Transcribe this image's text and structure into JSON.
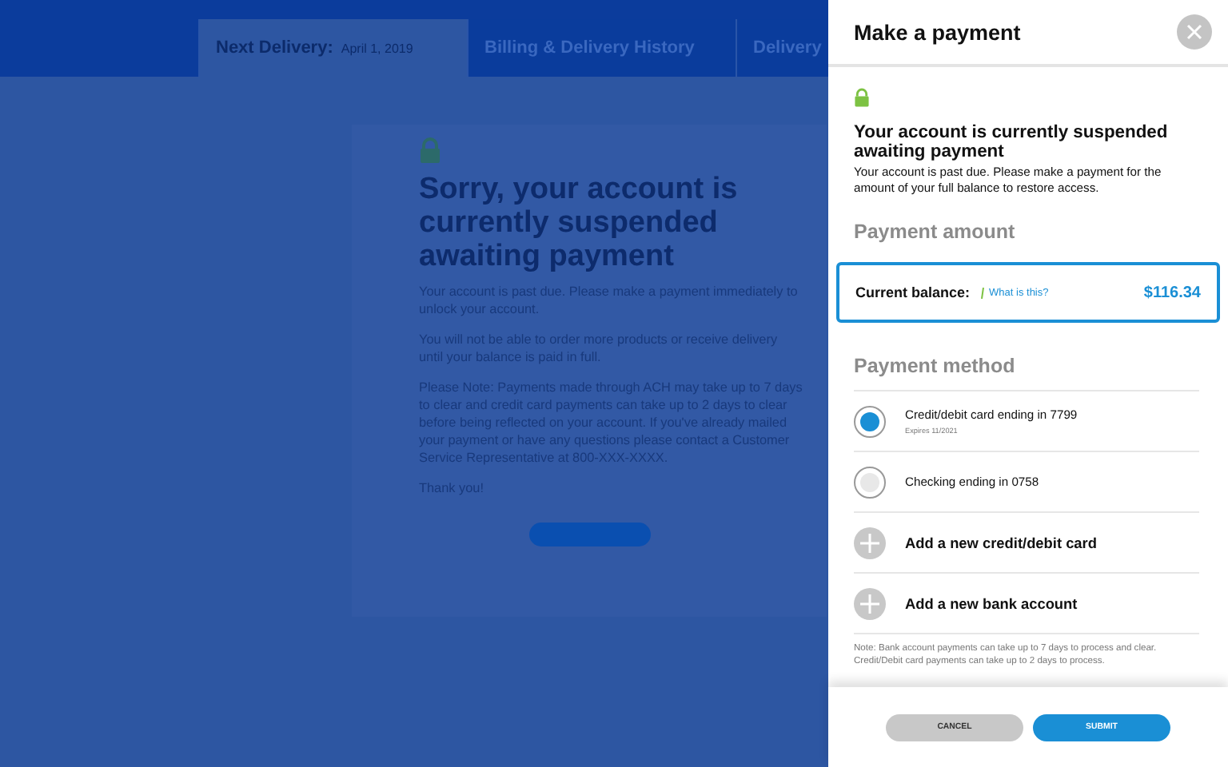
{
  "tabs": [
    {
      "label": "Next Delivery:",
      "detail": "April 1, 2019",
      "selected": true
    },
    {
      "label": "Billing & Delivery History",
      "selected": false
    },
    {
      "label": "Delivery",
      "selected": false
    }
  ],
  "notice": {
    "title": "Sorry, your account is currently suspended awaiting payment",
    "paragraphs": [
      "Your account is past due. Please make a payment immediately to unlock your account.",
      "You will not be able to order more products or receive delivery until your balance is paid in full.",
      "Please Note: Payments made through ACH may take up to 7 days to clear and credit card payments can take up to 2 days to clear before being reflected on your account. If you've already mailed your payment or have any questions please contact a Customer Service Representative at 800-XXX-XXXX.",
      "Thank you!"
    ]
  },
  "panel": {
    "title": "Make a payment",
    "alert_title": "Your account is currently suspended awaiting payment",
    "alert_text": "Your account is past due. Please make a payment for the amount of your full balance to restore access.",
    "amount_heading": "Payment amount",
    "balance_label": "Current balance:",
    "help_link": "What is this?",
    "balance": "$116.34",
    "method_heading": "Payment method",
    "methods": [
      {
        "kind": "radio",
        "label": "Credit/debit card ending in 7799",
        "sub": "Expires 11/2021",
        "selected": true
      },
      {
        "kind": "radio",
        "label": "Checking ending in 0758",
        "selected": false
      },
      {
        "kind": "add",
        "label": "Add a new credit/debit card"
      },
      {
        "kind": "add",
        "label": "Add a new bank account"
      }
    ],
    "note": "Note: Bank account payments can take up to 7 days to process and clear. Credit/Debit card payments can take up to 2 days to process.",
    "buttons": [
      "CANCEL",
      "SUBMIT"
    ]
  }
}
